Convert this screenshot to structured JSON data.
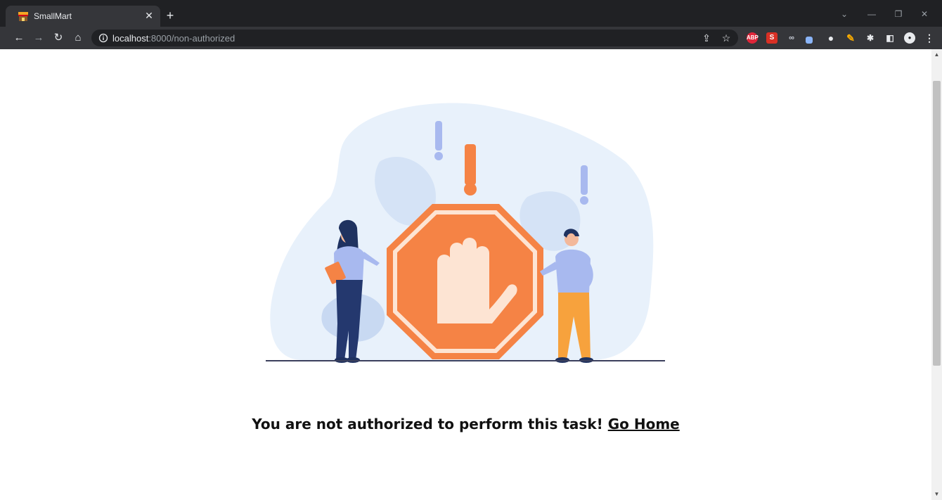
{
  "browser": {
    "tab": {
      "title": "SmallMart",
      "favicon": "storefront-icon"
    },
    "url": {
      "host": "localhost",
      "rest": ":8000/non-authorized"
    },
    "extensions": [
      "adblock-plus",
      "s-extension",
      "spectacles",
      "dropper",
      "globe",
      "pencil",
      "puzzle",
      "sidebar",
      "profile"
    ]
  },
  "page": {
    "message": "You are not authorized to perform this task!",
    "link_label": "Go Home",
    "illustration": "stop-sign-hand-illustration"
  },
  "colors": {
    "accent_orange": "#f58345",
    "navy": "#24386e",
    "lavender": "#a8b9ef",
    "blob": "#e8f1fb"
  }
}
